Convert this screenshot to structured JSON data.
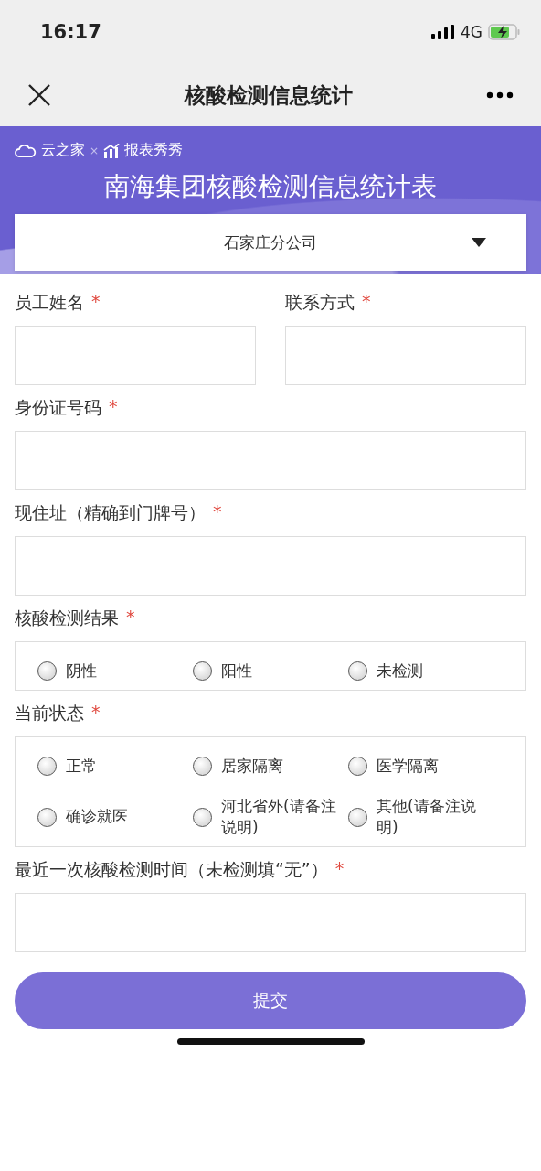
{
  "status_bar": {
    "time": "16:17",
    "network": "4G"
  },
  "nav": {
    "title": "核酸检测信息统计"
  },
  "banner": {
    "brand": "云之家",
    "separator": "×",
    "partner": "报表秀秀",
    "title": "南海集团核酸检测信息统计表"
  },
  "branch_select": {
    "value": "石家庄分公司"
  },
  "rows": [
    [
      {
        "kind": "text",
        "label": "员工姓名",
        "required_mark": "*"
      },
      {
        "kind": "text",
        "label": "联系方式",
        "required_mark": "*"
      }
    ],
    [
      {
        "kind": "text",
        "label": "身份证号码",
        "required_mark": "*"
      }
    ],
    [
      {
        "kind": "text",
        "label": "现住址（精确到门牌号）",
        "required_mark": "*"
      }
    ],
    [
      {
        "kind": "radio",
        "label": "核酸检测结果",
        "required_mark": "*",
        "options": [
          {
            "label": "阴性",
            "selected": false
          },
          {
            "label": "阳性",
            "selected": false
          },
          {
            "label": "未检测",
            "selected": false
          }
        ]
      }
    ],
    [
      {
        "kind": "radio",
        "label": "当前状态",
        "required_mark": "*",
        "options": [
          {
            "label": "正常",
            "selected": false
          },
          {
            "label": "居家隔离",
            "selected": false
          },
          {
            "label": "医学隔离",
            "selected": false
          },
          {
            "label": "确诊就医",
            "selected": false
          },
          {
            "label": "河北省外(请备注说明)",
            "selected": false
          },
          {
            "label": "其他(请备注说明)",
            "selected": false
          }
        ]
      }
    ],
    [
      {
        "kind": "text",
        "label": "最近一次核酸检测时间（未检测填“无”）",
        "required_mark": "*"
      }
    ]
  ],
  "submit": "提交"
}
